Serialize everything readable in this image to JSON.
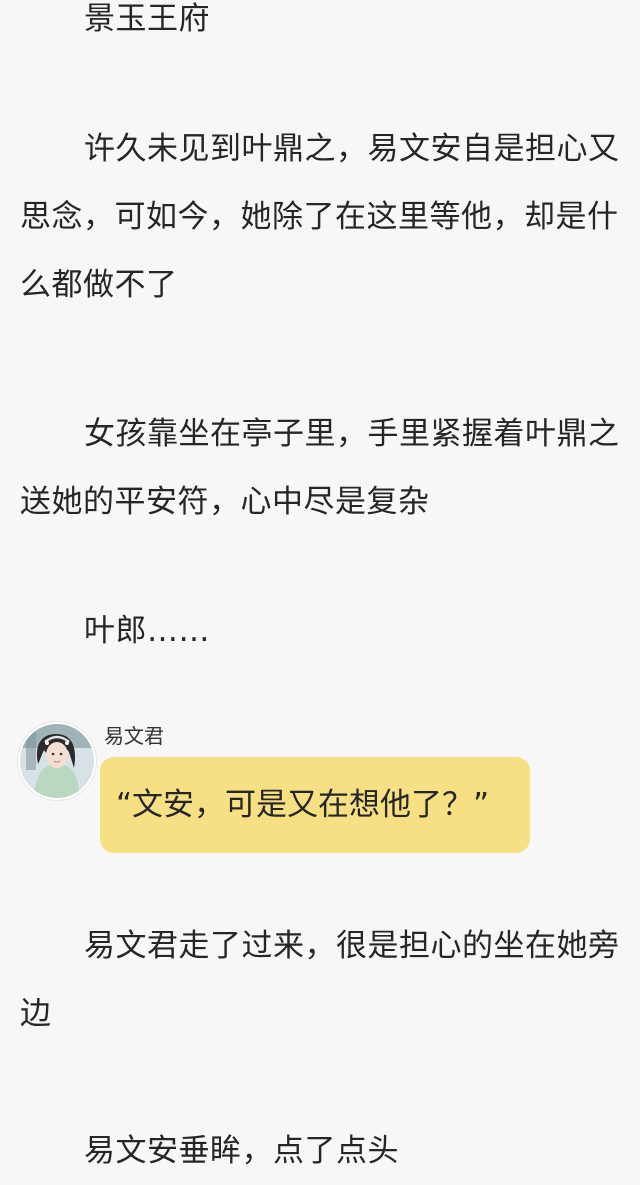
{
  "paragraphs": [
    "景玉王府",
    "许久未见到叶鼎之，易文安自是担心又思念，可如今，她除了在这里等他，却是什么都做不了",
    "女孩靠坐在亭子里，手里紧握着叶鼎之送她的平安符，心中尽是复杂",
    "叶郎……",
    "易文君走了过来，很是担心的坐在她旁边",
    "易文安垂眸，点了点头"
  ],
  "dialogue": {
    "speaker": "易文君",
    "text": "“文安，可是又在想他了？”",
    "bubble_color": "#f7df83",
    "avatar_icon": "portrait-avatar-icon"
  }
}
